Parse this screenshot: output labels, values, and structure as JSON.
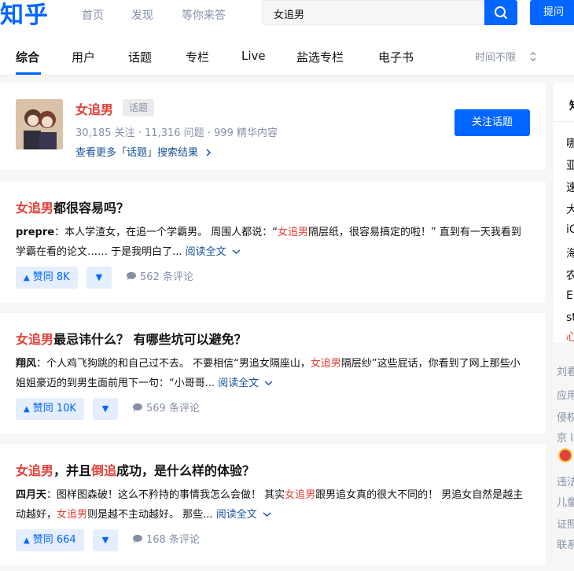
{
  "header": {
    "logo": "知乎",
    "nav": [
      "首页",
      "发现",
      "等你来答"
    ],
    "search_value": "女追男",
    "ask_label": "提问"
  },
  "tabs": {
    "items": [
      "综合",
      "用户",
      "话题",
      "专栏",
      "Live",
      "盐选专栏",
      "电子书"
    ],
    "active_index": 0,
    "time_filter": "时间不限"
  },
  "topic": {
    "title": "女追男",
    "tag": "话题",
    "stats": "30,185 关注 · 11,316 问题 · 999 精华内容",
    "more": "查看更多「话题」搜索结果",
    "follow_label": "关注话题"
  },
  "results": [
    {
      "title_parts": [
        {
          "text": "女追男",
          "hl": true
        },
        {
          "text": "都很容易吗？",
          "hl": false
        }
      ],
      "author": "prepre",
      "excerpt_parts": [
        {
          "text": "：本人学渣女，在追一个学霸男。 周围人都说：“",
          "hl": false
        },
        {
          "text": "女追男",
          "hl": true
        },
        {
          "text": "隔层纸，很容易搞定的啦！” 直到有一天我看到学霸在看的论文…… 于是我明白了... ",
          "hl": false
        }
      ],
      "read_more": "阅读全文",
      "vote": "赞同 8K",
      "comments": "562 条评论"
    },
    {
      "title_parts": [
        {
          "text": "女追男",
          "hl": true
        },
        {
          "text": "最忌讳什么？ 有哪些坑可以避免？",
          "hl": false
        }
      ],
      "author": "翔风",
      "excerpt_parts": [
        {
          "text": "：个人鸡飞狗跳的和自己过不去。 不要相信“男追女隔座山，",
          "hl": false
        },
        {
          "text": "女追男",
          "hl": true
        },
        {
          "text": "隔层纱”这些屁话，你看到了网上那些小姐姐豪迈的到男生面前甩下一句：“小哥哥... ",
          "hl": false
        }
      ],
      "read_more": "阅读全文",
      "vote": "赞同 10K",
      "comments": "569 条评论"
    },
    {
      "title_parts": [
        {
          "text": "女追男",
          "hl": true
        },
        {
          "text": "，并且",
          "hl": false
        },
        {
          "text": "倒追",
          "hl": true
        },
        {
          "text": "成功，是什么样的体验？",
          "hl": false
        }
      ],
      "author": "四月天",
      "excerpt_parts": [
        {
          "text": "：图样图森破！这么不矜持的事情我怎么会做！ 其实",
          "hl": false
        },
        {
          "text": "女追男",
          "hl": true
        },
        {
          "text": "跟男追女真的很大不同的！ 男追女自然是越主动越好，",
          "hl": false
        },
        {
          "text": "女追男",
          "hl": true
        },
        {
          "text": "则是越不主动越好。 那些... ",
          "hl": false
        }
      ],
      "read_more": "阅读全文",
      "vote": "赞同 664",
      "comments": "168 条评论"
    }
  ],
  "sidebar": {
    "header": "知",
    "items": [
      "哪",
      "亚",
      "速",
      "大",
      "iC",
      "海",
      "农",
      "El",
      "st",
      "心"
    ],
    "footer": [
      "刘看",
      "应用",
      "侵权",
      "京 I",
      "违法",
      "儿童",
      "证照",
      "联系"
    ]
  }
}
